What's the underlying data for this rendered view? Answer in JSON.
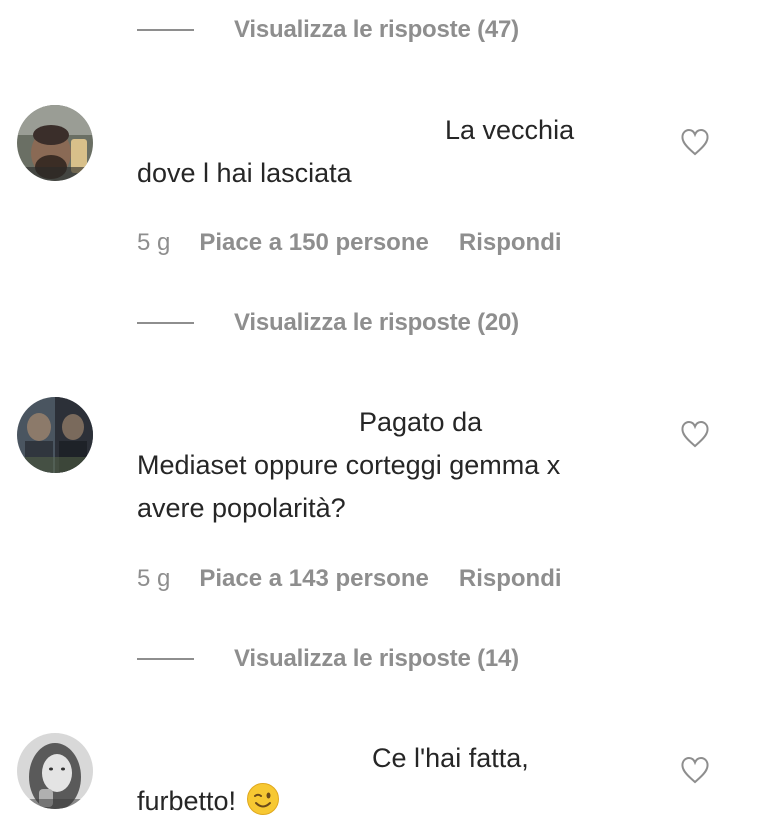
{
  "thread_top": {
    "view_replies_label": "Visualizza le risposte (47)"
  },
  "comments": [
    {
      "text_line1": "La vecchia",
      "text_rest": "dove l hai lasciata",
      "time": "5 g",
      "likes": "Piace a 150 persone",
      "reply_label": "Rispondi",
      "view_replies_label": "Visualizza le risposte (20)"
    },
    {
      "text_line1": "Pagato da",
      "text_rest": "Mediaset oppure corteggi gemma x avere popolarità?",
      "time": "5 g",
      "likes": "Piace a 143 persone",
      "reply_label": "Rispondi",
      "view_replies_label": "Visualizza le risposte (14)"
    },
    {
      "text_line1": "Ce l'hai fatta,",
      "text_rest": "furbetto!",
      "emoji": "winking-face-emoji"
    }
  ],
  "icons": {
    "like": "heart-outline-icon"
  },
  "colors": {
    "text": "#262626",
    "secondary": "#8e8e8e",
    "background": "#ffffff"
  }
}
